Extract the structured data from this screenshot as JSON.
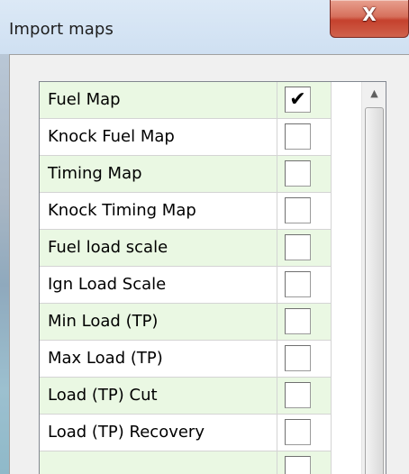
{
  "window": {
    "title": "Import maps",
    "close_glyph": "X"
  },
  "maps_list": {
    "rows": [
      {
        "name": "Fuel Map",
        "checked": true,
        "check_glyph": "✔"
      },
      {
        "name": "Knock Fuel Map",
        "checked": false,
        "check_glyph": ""
      },
      {
        "name": "Timing Map",
        "checked": false,
        "check_glyph": ""
      },
      {
        "name": "Knock Timing Map",
        "checked": false,
        "check_glyph": ""
      },
      {
        "name": "Fuel load scale",
        "checked": false,
        "check_glyph": ""
      },
      {
        "name": "Ign Load Scale",
        "checked": false,
        "check_glyph": ""
      },
      {
        "name": "Min Load (TP)",
        "checked": false,
        "check_glyph": ""
      },
      {
        "name": "Max Load (TP)",
        "checked": false,
        "check_glyph": ""
      },
      {
        "name": "Load (TP) Cut",
        "checked": false,
        "check_glyph": ""
      },
      {
        "name": "Load (TP) Recovery",
        "checked": false,
        "check_glyph": ""
      },
      {
        "name": "",
        "checked": false,
        "check_glyph": ""
      }
    ]
  },
  "scrollbar": {
    "up_arrow_glyph": "▲"
  },
  "colors": {
    "row_alt_background": "#eaf8e3",
    "close_button": "#c5412d"
  }
}
